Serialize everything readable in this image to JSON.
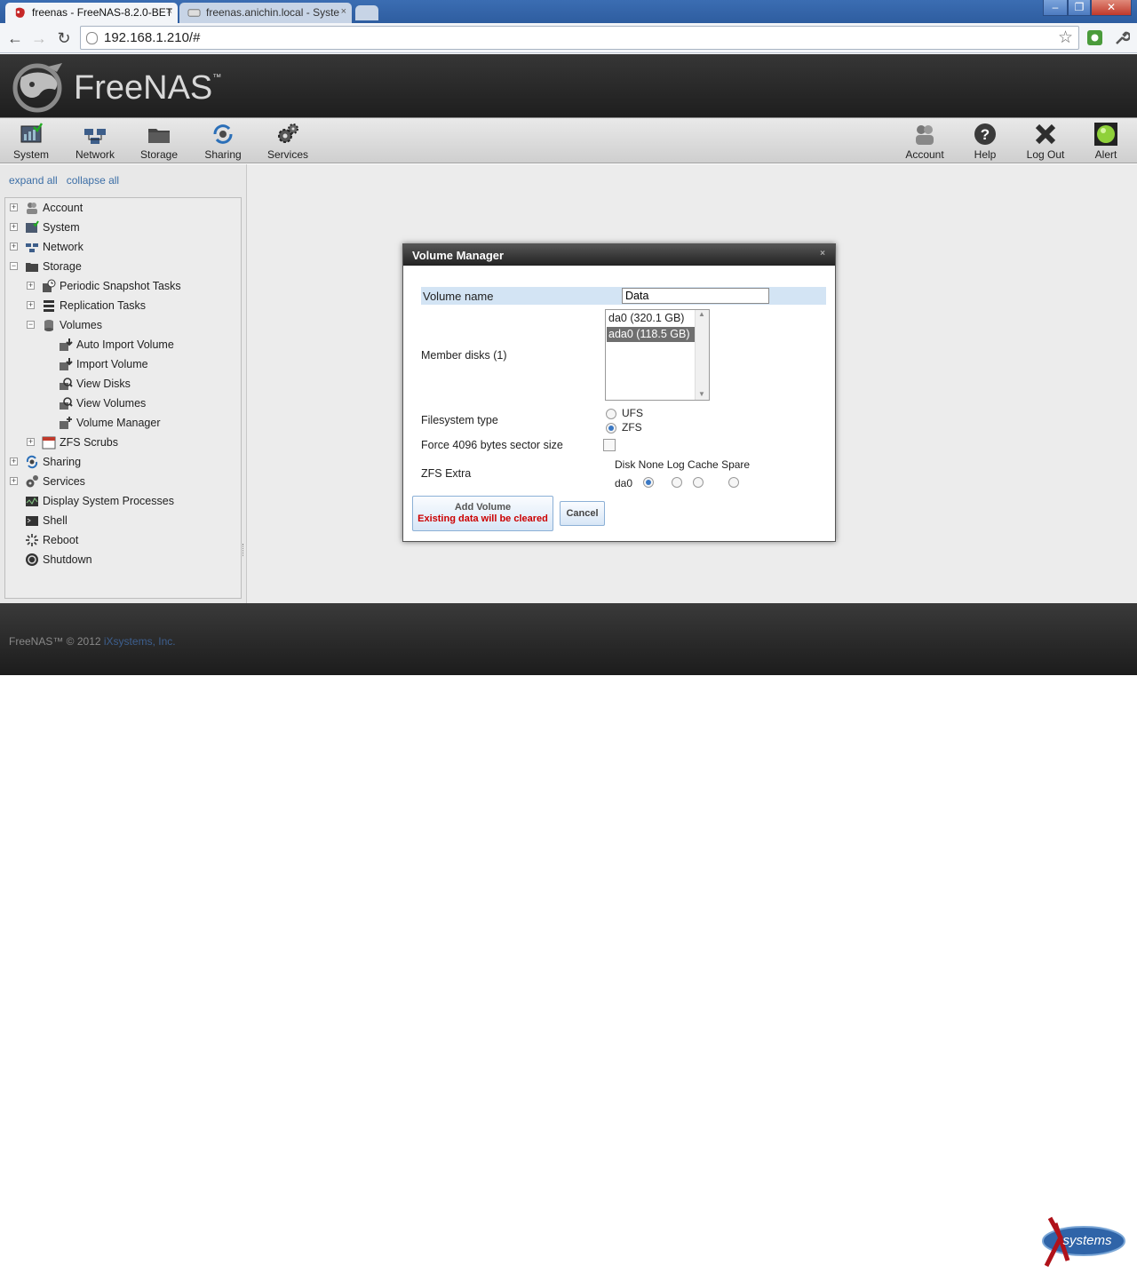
{
  "browser": {
    "tabs": [
      {
        "label": "freenas - FreeNAS-8.2.0-BET",
        "close": "×",
        "icon": "freenas-favicon"
      },
      {
        "label": "freenas.anichin.local - Syste",
        "close": "×",
        "icon": "page-icon"
      }
    ],
    "url": "192.168.1.210/#",
    "window_controls": [
      "–",
      "❐",
      "✕"
    ]
  },
  "header": {
    "logo_text": "FreeNAS",
    "logo_tm": "™"
  },
  "nav": {
    "left": [
      {
        "label": "System",
        "icon": "system-icon"
      },
      {
        "label": "Network",
        "icon": "network-icon"
      },
      {
        "label": "Storage",
        "icon": "storage-icon"
      },
      {
        "label": "Sharing",
        "icon": "sharing-icon"
      },
      {
        "label": "Services",
        "icon": "services-icon"
      }
    ],
    "right": [
      {
        "label": "Account",
        "icon": "account-icon"
      },
      {
        "label": "Help",
        "icon": "help-icon"
      },
      {
        "label": "Log Out",
        "icon": "logout-icon"
      },
      {
        "label": "Alert",
        "icon": "alert-icon"
      }
    ]
  },
  "sidebar": {
    "expand_all": "expand all",
    "collapse_all": "collapse all",
    "tree": [
      {
        "label": "Account",
        "toggle": "+"
      },
      {
        "label": "System",
        "toggle": "+"
      },
      {
        "label": "Network",
        "toggle": "+"
      },
      {
        "label": "Storage",
        "toggle": "−"
      },
      {
        "label": "Periodic Snapshot Tasks",
        "toggle": "+"
      },
      {
        "label": "Replication Tasks",
        "toggle": "+"
      },
      {
        "label": "Volumes",
        "toggle": "−"
      },
      {
        "label": "Auto Import Volume"
      },
      {
        "label": "Import Volume"
      },
      {
        "label": "View Disks"
      },
      {
        "label": "View Volumes"
      },
      {
        "label": "Volume Manager"
      },
      {
        "label": "ZFS Scrubs",
        "toggle": "+"
      },
      {
        "label": "Sharing",
        "toggle": "+"
      },
      {
        "label": "Services",
        "toggle": "+"
      },
      {
        "label": "Display System Processes"
      },
      {
        "label": "Shell"
      },
      {
        "label": "Reboot"
      },
      {
        "label": "Shutdown"
      }
    ]
  },
  "dialog": {
    "title": "Volume Manager",
    "close": "×",
    "volume_name_label": "Volume name",
    "volume_name_value": "Data",
    "member_disks_label": "Member disks (1)",
    "disks": [
      {
        "label": "da0 (320.1 GB)",
        "selected": false
      },
      {
        "label": "ada0 (118.5 GB)",
        "selected": true
      }
    ],
    "filesystem_label": "Filesystem type",
    "fs_options": [
      {
        "label": "UFS",
        "checked": false
      },
      {
        "label": "ZFS",
        "checked": true
      }
    ],
    "force_label": "Force 4096 bytes sector size",
    "zfs_extra_label": "ZFS Extra",
    "zfs_extra_header": "Disk None Log Cache Spare",
    "zfs_extra_row_disk": "da0",
    "zfs_extra_selected": "None",
    "add_volume_label": "Add Volume",
    "add_volume_warning": "Existing data will be cleared",
    "cancel_label": "Cancel"
  },
  "footer": {
    "copyright": "FreeNAS™ © 2012 ",
    "company": "iXsystems, Inc.",
    "logo_text": "systems"
  },
  "colors": {
    "accent": "#3a78c4",
    "warning": "#cc0000",
    "highlight_row": "#d3e4f4"
  }
}
